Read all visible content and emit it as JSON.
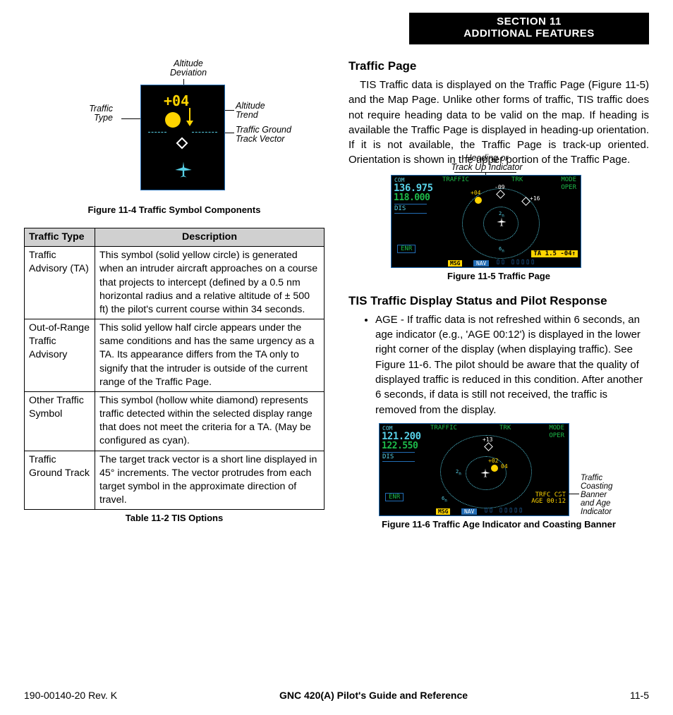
{
  "section": {
    "line1": "SECTION 11",
    "line2": "ADDITIONAL FEATURES"
  },
  "fig4": {
    "caption": "Figure 11-4  Traffic Symbol Components",
    "alt_text": "+04",
    "annot": {
      "alt_dev": "Altitude\nDeviation",
      "traffic_type": "Traffic\nType",
      "alt_trend": "Altitude\nTrend",
      "ground_track": "Traffic Ground\nTrack Vector"
    }
  },
  "table": {
    "caption": "Table 11-2  TIS Options",
    "headers": [
      "Traffic Type",
      "Description"
    ],
    "rows": [
      {
        "type": "Traffic Advisory (TA)",
        "desc": "This symbol (solid yellow circle) is generated when an intruder aircraft approaches on a course that projects to intercept (defined by a 0.5 nm horizontal radius and a relative altitude of ± 500 ft) the pilot's current course within 34 seconds."
      },
      {
        "type": "Out-of-Range Traffic Advisory",
        "desc": "This solid yellow half circle appears under the same conditions and has the same urgency as a TA.  Its appearance differs from the TA only to signify that the intruder is outside of the current range of the Traffic Page."
      },
      {
        "type": "Other Traffic Symbol",
        "desc": "This symbol (hollow white diamond) represents traffic detected within the selected display range that does not meet the criteria for a TA.  (May be configured as cyan)."
      },
      {
        "type": "Traffic Ground Track",
        "desc": "The target track vector is a short line displayed in 45° increments.  The vector protrudes from each target symbol in the approximate direction of travel."
      }
    ]
  },
  "right": {
    "h_traffic_page": "Traffic Page",
    "p_traffic_page": "TIS Traffic data is displayed on the Traffic Page (Figure 11-5) and the Map Page.  Unlike other forms of traffic, TIS traffic does not require heading data to be valid on the map.  If heading is available the Traffic Page is displayed in heading-up orientation.  If it is not available, the Traffic Page is track-up oriented.  Orientation is shown in the upper portion of the Traffic Page.",
    "fig5": {
      "annot_top": "Heading or\nTrack Up Indicator",
      "caption": "Figure 11-5  Traffic Page",
      "freq1": "136.975",
      "freq2": "118.000",
      "lbl_traffic": "TRAFFIC",
      "lbl_trk": "TRK",
      "lbl_mode": "MODE",
      "lbl_oper": "OPER",
      "dis": "DIS",
      "enr": "ENR",
      "msg": "MSG",
      "nav": "NAV",
      "ta_banner": "TA 1.5 -04↑",
      "targets": [
        "+04",
        "-09",
        "+16"
      ],
      "rings": [
        "2",
        "6"
      ]
    },
    "h_status": "TIS Traffic Display Status and Pilot Response",
    "bullet_age": "AGE - If traffic data is not refreshed within 6 seconds, an age indicator (e.g., 'AGE 00:12') is displayed in the lower right corner of the display (when displaying traffic).  See Figure 11-6.  The pilot should be aware that the quality of displayed traffic is reduced in this condition.  After another 6 seconds, if data is still not received, the traffic is removed from the display.",
    "fig6": {
      "caption": "Figure 11-6  Traffic Age Indicator and Coasting Banner",
      "freq1": "121.200",
      "freq2": "122.550",
      "age_l1": "TRFC CST",
      "age_l2": "AGE 00:12",
      "targets": [
        "+13",
        "+02",
        "04"
      ],
      "side_annot": "Traffic\nCoasting\nBanner\nand Age\nIndicator"
    }
  },
  "footer": {
    "left": "190-00140-20  Rev. K",
    "mid": "GNC 420(A) Pilot's Guide and Reference",
    "right": "11-5"
  }
}
